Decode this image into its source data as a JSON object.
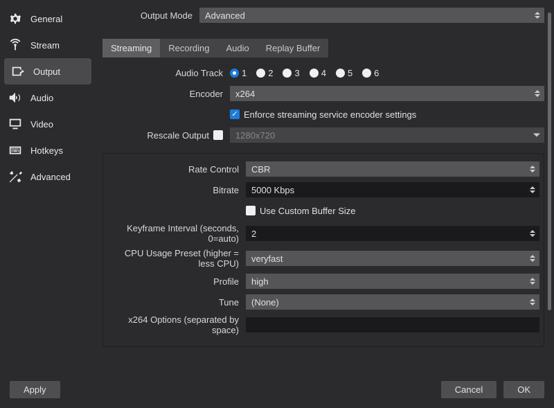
{
  "sidebar": {
    "items": [
      {
        "label": "General"
      },
      {
        "label": "Stream"
      },
      {
        "label": "Output"
      },
      {
        "label": "Audio"
      },
      {
        "label": "Video"
      },
      {
        "label": "Hotkeys"
      },
      {
        "label": "Advanced"
      }
    ]
  },
  "output_mode": {
    "label": "Output Mode",
    "value": "Advanced"
  },
  "tabs": [
    {
      "label": "Streaming"
    },
    {
      "label": "Recording"
    },
    {
      "label": "Audio"
    },
    {
      "label": "Replay Buffer"
    }
  ],
  "audio_track": {
    "label": "Audio Track",
    "options": [
      "1",
      "2",
      "3",
      "4",
      "5",
      "6"
    ],
    "selected": "1"
  },
  "encoder": {
    "label": "Encoder",
    "value": "x264"
  },
  "enforce": {
    "label": "Enforce streaming service encoder settings",
    "checked": true
  },
  "rescale": {
    "label": "Rescale Output",
    "checked": false,
    "value": "1280x720"
  },
  "rate_control": {
    "label": "Rate Control",
    "value": "CBR"
  },
  "bitrate": {
    "label": "Bitrate",
    "value": "5000 Kbps"
  },
  "custom_buffer": {
    "label": "Use Custom Buffer Size",
    "checked": false
  },
  "keyframe": {
    "label": "Keyframe Interval (seconds, 0=auto)",
    "value": "2"
  },
  "cpu_preset": {
    "label": "CPU Usage Preset (higher = less CPU)",
    "value": "veryfast"
  },
  "profile": {
    "label": "Profile",
    "value": "high"
  },
  "tune": {
    "label": "Tune",
    "value": "(None)"
  },
  "x264_options": {
    "label": "x264 Options (separated by space)",
    "value": ""
  },
  "footer": {
    "apply": "Apply",
    "cancel": "Cancel",
    "ok": "OK"
  }
}
